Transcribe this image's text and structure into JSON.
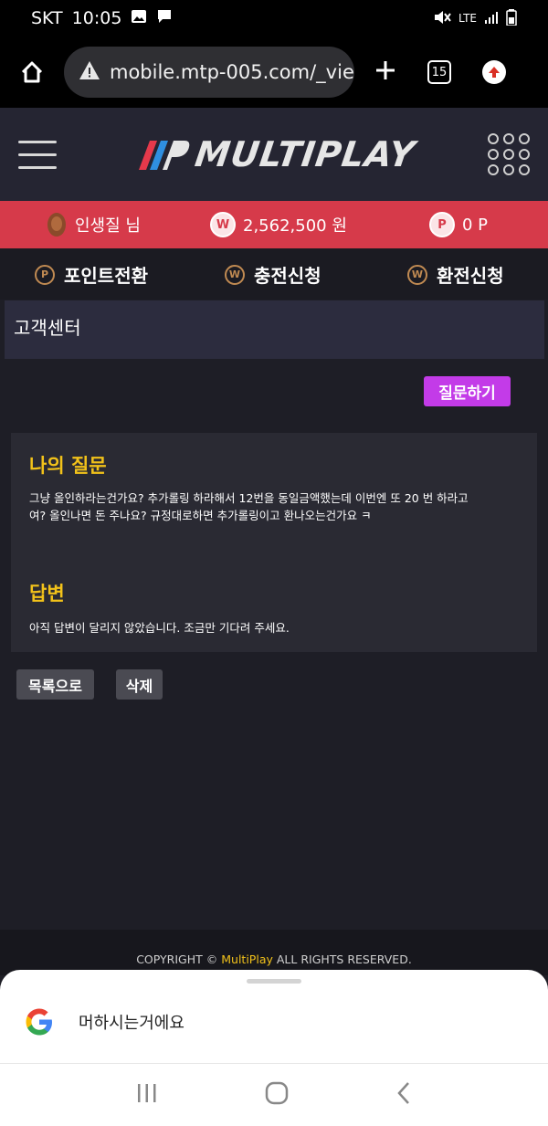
{
  "status_bar": {
    "carrier": "SKT",
    "time": "10:05",
    "network": "LTE"
  },
  "browser": {
    "url": "mobile.mtp-005.com/_vie",
    "tab_count": "15"
  },
  "site": {
    "logo_text": "MULTIPLAY"
  },
  "user_bar": {
    "nickname": "인생질 님",
    "balance": "2,562,500 원",
    "points": "0 P",
    "won_symbol": "W",
    "point_symbol": "P"
  },
  "actions": {
    "point_exchange": "포인트전환",
    "deposit_request": "충전신청",
    "withdraw_request": "환전신청"
  },
  "page": {
    "title": "고객센터",
    "ask_button": "질문하기",
    "question_heading": "나의 질문",
    "question_text_line1": "그냥 올인하라는건가요? 추가롤링 하라해서 12번을 동일금액했는데 이번엔 또 20 번 하라고",
    "question_text_line2": "여? 올인나면 돈 주나요? 규정대로하면 추가롤링이고 환나오는건가요 ㅋ",
    "answer_heading": "답변",
    "answer_text": "아직 답변이 달리지 않았습니다. 조금만 기다려 주세요.",
    "list_button": "목록으로",
    "delete_button": "삭제"
  },
  "footer": {
    "prefix": "COPYRIGHT ©",
    "brand": "MultiPlay",
    "suffix": "ALL RIGHTS RESERVED."
  },
  "google_sheet": {
    "query": "머하시는거에요"
  },
  "colors": {
    "accent_red": "#d63a4a",
    "ask_purple": "#c33be8",
    "heading_yellow": "#f2c21a"
  }
}
